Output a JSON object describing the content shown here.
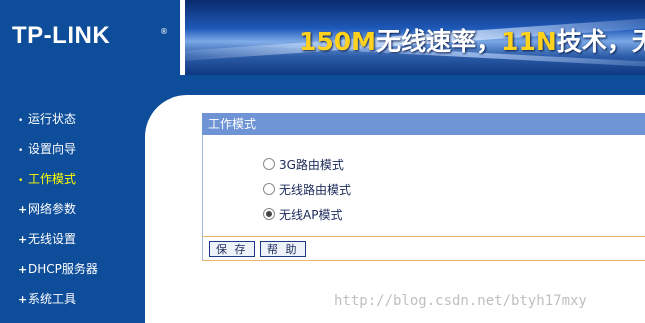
{
  "header": {
    "logo_text": "TP-LINK",
    "logo_reg": "®",
    "slogan_part1": "150M",
    "slogan_part2": "无线速率，",
    "slogan_part3": "11N",
    "slogan_part4": "技术，无"
  },
  "sidebar": {
    "items": [
      {
        "label": "运行状态",
        "marker": "•",
        "active": false
      },
      {
        "label": "设置向导",
        "marker": "•",
        "active": false
      },
      {
        "label": "工作模式",
        "marker": "•",
        "active": true
      },
      {
        "label": "网络参数",
        "marker": "+",
        "active": false
      },
      {
        "label": "无线设置",
        "marker": "+",
        "active": false
      },
      {
        "label": "DHCP服务器",
        "marker": "+",
        "active": false
      },
      {
        "label": "系统工具",
        "marker": "+",
        "active": false
      }
    ]
  },
  "panel": {
    "title": "工作模式",
    "options": [
      {
        "label": "3G路由模式",
        "checked": false
      },
      {
        "label": "无线路由模式",
        "checked": false
      },
      {
        "label": "无线AP模式",
        "checked": true
      }
    ],
    "save_label": "保 存",
    "help_label": "帮 助"
  },
  "watermark": "http://blog.csdn.net/btyh17mxy",
  "colors": {
    "brand_blue": "#0d4d9a",
    "active_nav": "#ffff00",
    "panel_title": "#6f94d6",
    "slogan_highlight": "#ffd21e"
  }
}
